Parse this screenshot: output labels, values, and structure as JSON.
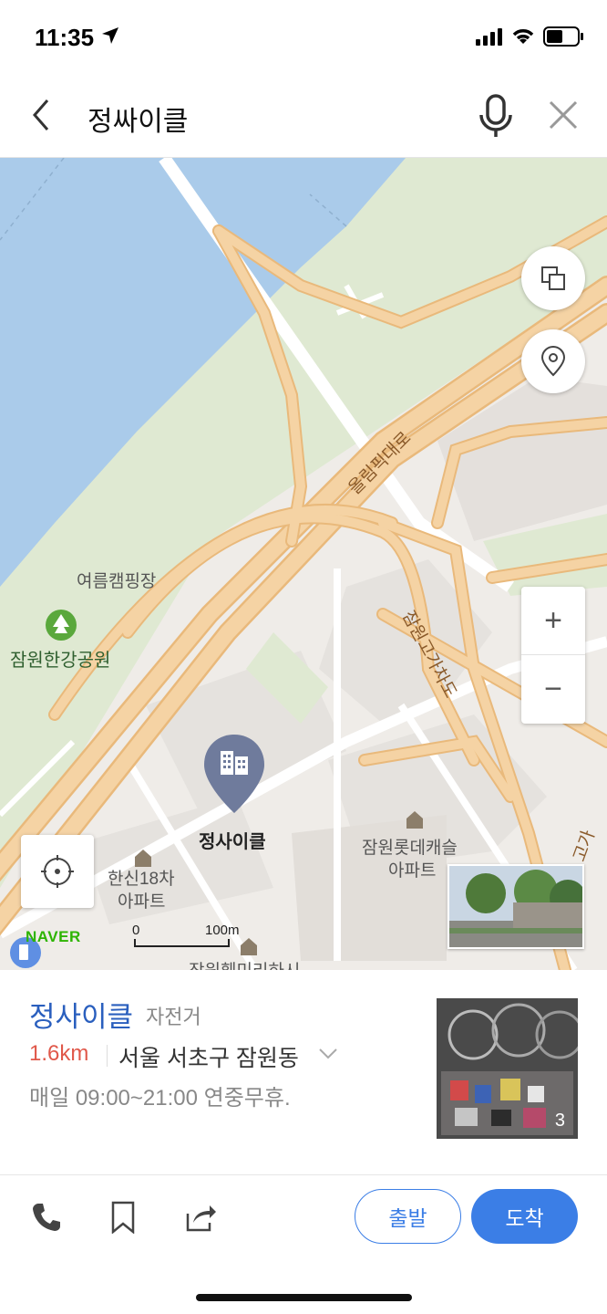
{
  "status_bar": {
    "time": "11:35"
  },
  "search": {
    "query": "정싸이클"
  },
  "map": {
    "labels": {
      "camping": "여름캠핑장",
      "park": "잠원한강공원",
      "road1": "올림픽대로",
      "road2": "잠원고가차도",
      "road3": "고가",
      "place": "정사이클",
      "apt1_line1": "한신18차",
      "apt1_line2": "아파트",
      "apt2_line1": "잠원롯데캐슬",
      "apt2_line2": "아파트",
      "cutoff": "잠원훼미리하시"
    },
    "zoom_in": "+",
    "zoom_out": "−",
    "logo": "NAVER",
    "scale_start": "0",
    "scale_end": "100m"
  },
  "place": {
    "name": "정사이클",
    "category": "자전거",
    "distance": "1.6km",
    "address": "서울 서초구 잠원동",
    "hours": "매일 09:00~21:00 연중무휴.",
    "photo_count": "3"
  },
  "actions": {
    "start_label": "출발",
    "arrive_label": "도착"
  },
  "colors": {
    "accent": "#3b7ee6",
    "distance": "#e0584a",
    "place_name": "#2a5fbe",
    "road": "#f2c98e",
    "water": "#aacbea",
    "park": "#dde9cf"
  }
}
